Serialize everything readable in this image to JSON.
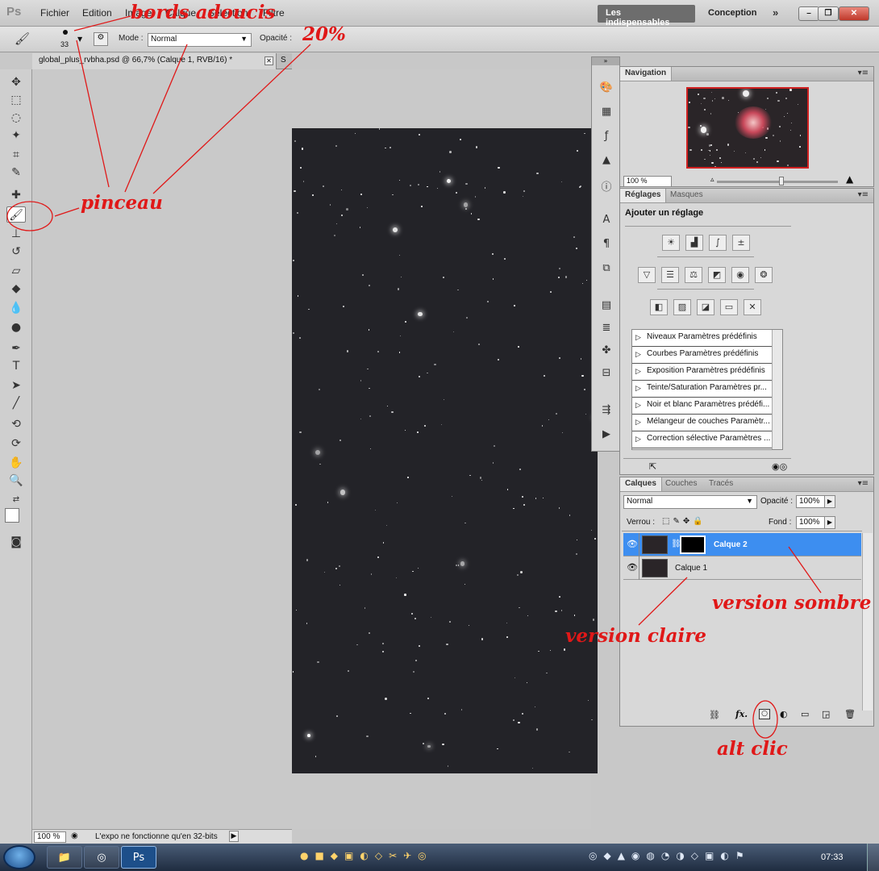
{
  "app": {
    "logo": "Ps"
  },
  "menu": {
    "items": [
      "Fichier",
      "Edition",
      "Image",
      "Calque",
      "Sélection",
      "Filtre"
    ]
  },
  "workspace": {
    "essentials": "Les indispensables",
    "design": "Conception",
    "more": "»"
  },
  "window_controls": {
    "minimize": "–",
    "restore": "❐",
    "close": "✕"
  },
  "options_bar": {
    "brush_size": "33",
    "mode_label": "Mode :",
    "mode_value": "Normal",
    "opacity_label": "Opacité :"
  },
  "document": {
    "tab_title": "global_plus_rvbha.psd @ 66,7% (Calque 1, RVB/16) *",
    "next_tab": "S",
    "close": "✕"
  },
  "status_bar": {
    "zoom": "100 %",
    "message": "L'expo ne fonctionne qu'en 32-bits"
  },
  "navigation": {
    "tab": "Navigation",
    "zoom": "100 %"
  },
  "adjustments": {
    "tabs": [
      "Réglages",
      "Masques"
    ],
    "title": "Ajouter un réglage",
    "presets": [
      "Niveaux Paramètres prédéfinis",
      "Courbes Paramètres prédéfinis",
      "Exposition Paramètres prédéfinis",
      "Teinte/Saturation Paramètres pr...",
      "Noir et blanc Paramètres prédéfi...",
      "Mélangeur de couches Paramètr...",
      "Correction sélective Paramètres ..."
    ]
  },
  "layers": {
    "tabs": [
      "Calques",
      "Couches",
      "Tracés"
    ],
    "blend_mode": "Normal",
    "opacity_label": "Opacité :",
    "opacity_value": "100%",
    "lock_label": "Verrou :",
    "fill_label": "Fond :",
    "fill_value": "100%",
    "items": [
      {
        "name": "Calque 2",
        "selected": true,
        "has_mask": true
      },
      {
        "name": "Calque 1",
        "selected": false,
        "has_mask": false
      }
    ],
    "selected_color": "#3d8ef0"
  },
  "taskbar": {
    "time": "07:33"
  },
  "annotations": {
    "bords": "bords adoucis",
    "opacity": "20%",
    "pinceau": "pinceau",
    "sombre": "version sombre",
    "claire": "version claire",
    "alt": "alt clic",
    "color": "#e01818"
  }
}
